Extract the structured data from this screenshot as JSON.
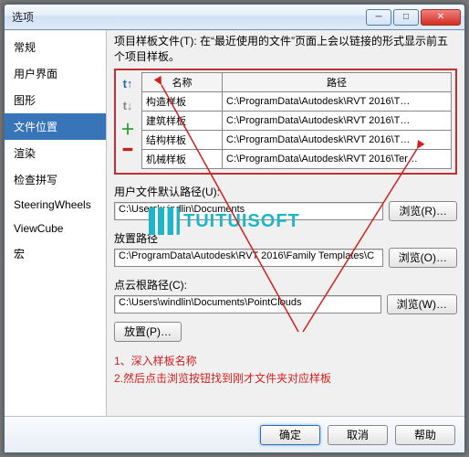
{
  "window": {
    "title": "选项"
  },
  "winbuttons": {
    "min": "─",
    "max": "□",
    "close": "✕"
  },
  "sidebar": {
    "items": [
      {
        "label": "常规"
      },
      {
        "label": "用户界面"
      },
      {
        "label": "图形"
      },
      {
        "label": "文件位置"
      },
      {
        "label": "渲染"
      },
      {
        "label": "检查拼写"
      },
      {
        "label": "SteeringWheels"
      },
      {
        "label": "ViewCube"
      },
      {
        "label": "宏"
      }
    ],
    "active_index": 3
  },
  "main": {
    "description": "项目样板文件(T): 在“最近使用的文件”页面上会以链接的形式显示前五个项目样板。",
    "toolbar": {
      "up": "t↑",
      "down": "t↓",
      "plus": "＋",
      "minus": "━"
    },
    "table": {
      "headers": {
        "name": "名称",
        "path": "路径"
      },
      "rows": [
        {
          "name": "构造样板",
          "path": "C:\\ProgramData\\Autodesk\\RVT 2016\\T…"
        },
        {
          "name": "建筑样板",
          "path": "C:\\ProgramData\\Autodesk\\RVT 2016\\T…"
        },
        {
          "name": "结构样板",
          "path": "C:\\ProgramData\\Autodesk\\RVT 2016\\T…"
        },
        {
          "name": "机械样板",
          "path": "C:\\ProgramData\\Autodesk\\RVT 2016\\Ter…"
        }
      ]
    },
    "field1": {
      "label": "用户文件默认路径(U):",
      "value": "C:\\Users\\windlin\\Documents",
      "browse": "浏览(R)…"
    },
    "field2": {
      "label": "放置路径",
      "value": "C:\\ProgramData\\Autodesk\\RVT 2016\\Family Templates\\C",
      "browse": "浏览(O)…"
    },
    "field3": {
      "label": "点云根路径(C):",
      "value": "C:\\Users\\windlin\\Documents\\PointClouds",
      "browse": "浏览(W)…"
    },
    "places_btn": "放置(P)…",
    "annotation": {
      "line1": "1、深入样板名称",
      "line2": "2.然后点击浏览按钮找到刚才文件夹对应样板"
    },
    "watermark": "TUITUISOFT"
  },
  "footer": {
    "ok": "确定",
    "cancel": "取消",
    "help": "帮助"
  }
}
